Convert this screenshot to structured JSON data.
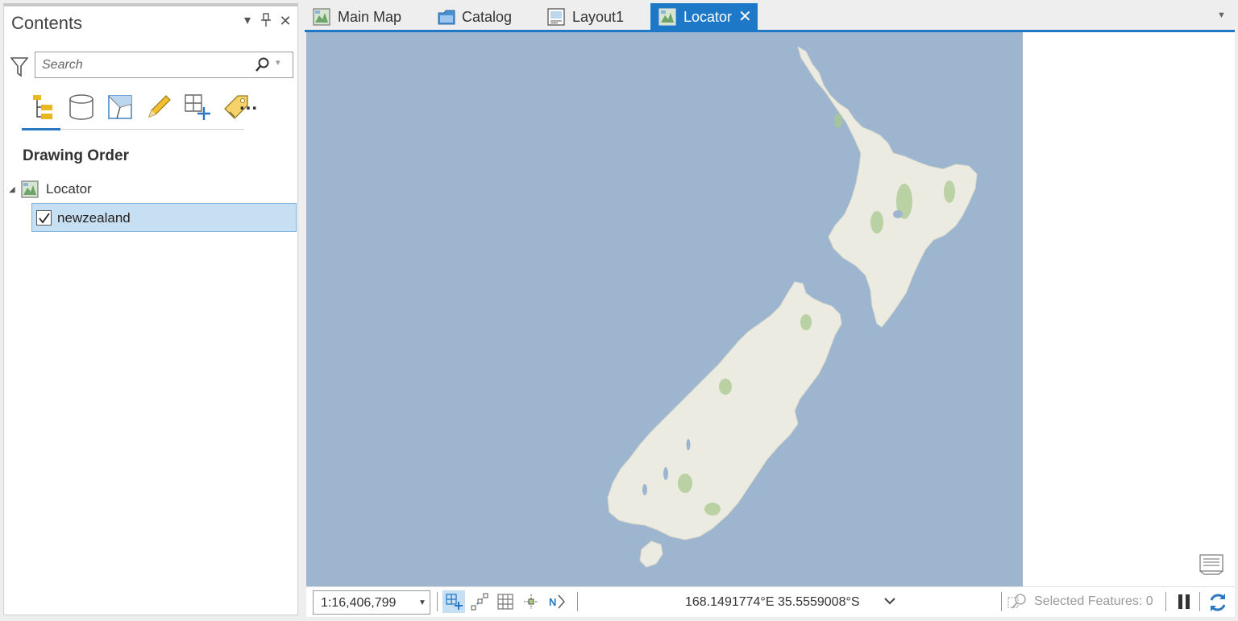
{
  "contents": {
    "title": "Contents",
    "search_placeholder": "Search",
    "section_heading": "Drawing Order",
    "map_name": "Locator",
    "layer_name": "newzealand",
    "layer_checked": true,
    "more_label": "..."
  },
  "tabs": [
    {
      "label": "Main Map",
      "icon": "map-icon",
      "active": false
    },
    {
      "label": "Catalog",
      "icon": "catalog-icon",
      "active": false
    },
    {
      "label": "Layout1",
      "icon": "layout-icon",
      "active": false
    },
    {
      "label": "Locator",
      "icon": "map-icon",
      "active": true,
      "close_glyph": "✕"
    }
  ],
  "map": {
    "water_color": "#9db5cf",
    "land_color": "#ecebe1",
    "vegetation_color": "#a9c98f"
  },
  "statusbar": {
    "scale": "1:16,406,799",
    "coordinates": "168.1491774°E 35.5559008°S",
    "selected_features": "Selected Features: 0"
  },
  "colors": {
    "accent": "#1e78c8",
    "selection": "#c7dff3"
  }
}
